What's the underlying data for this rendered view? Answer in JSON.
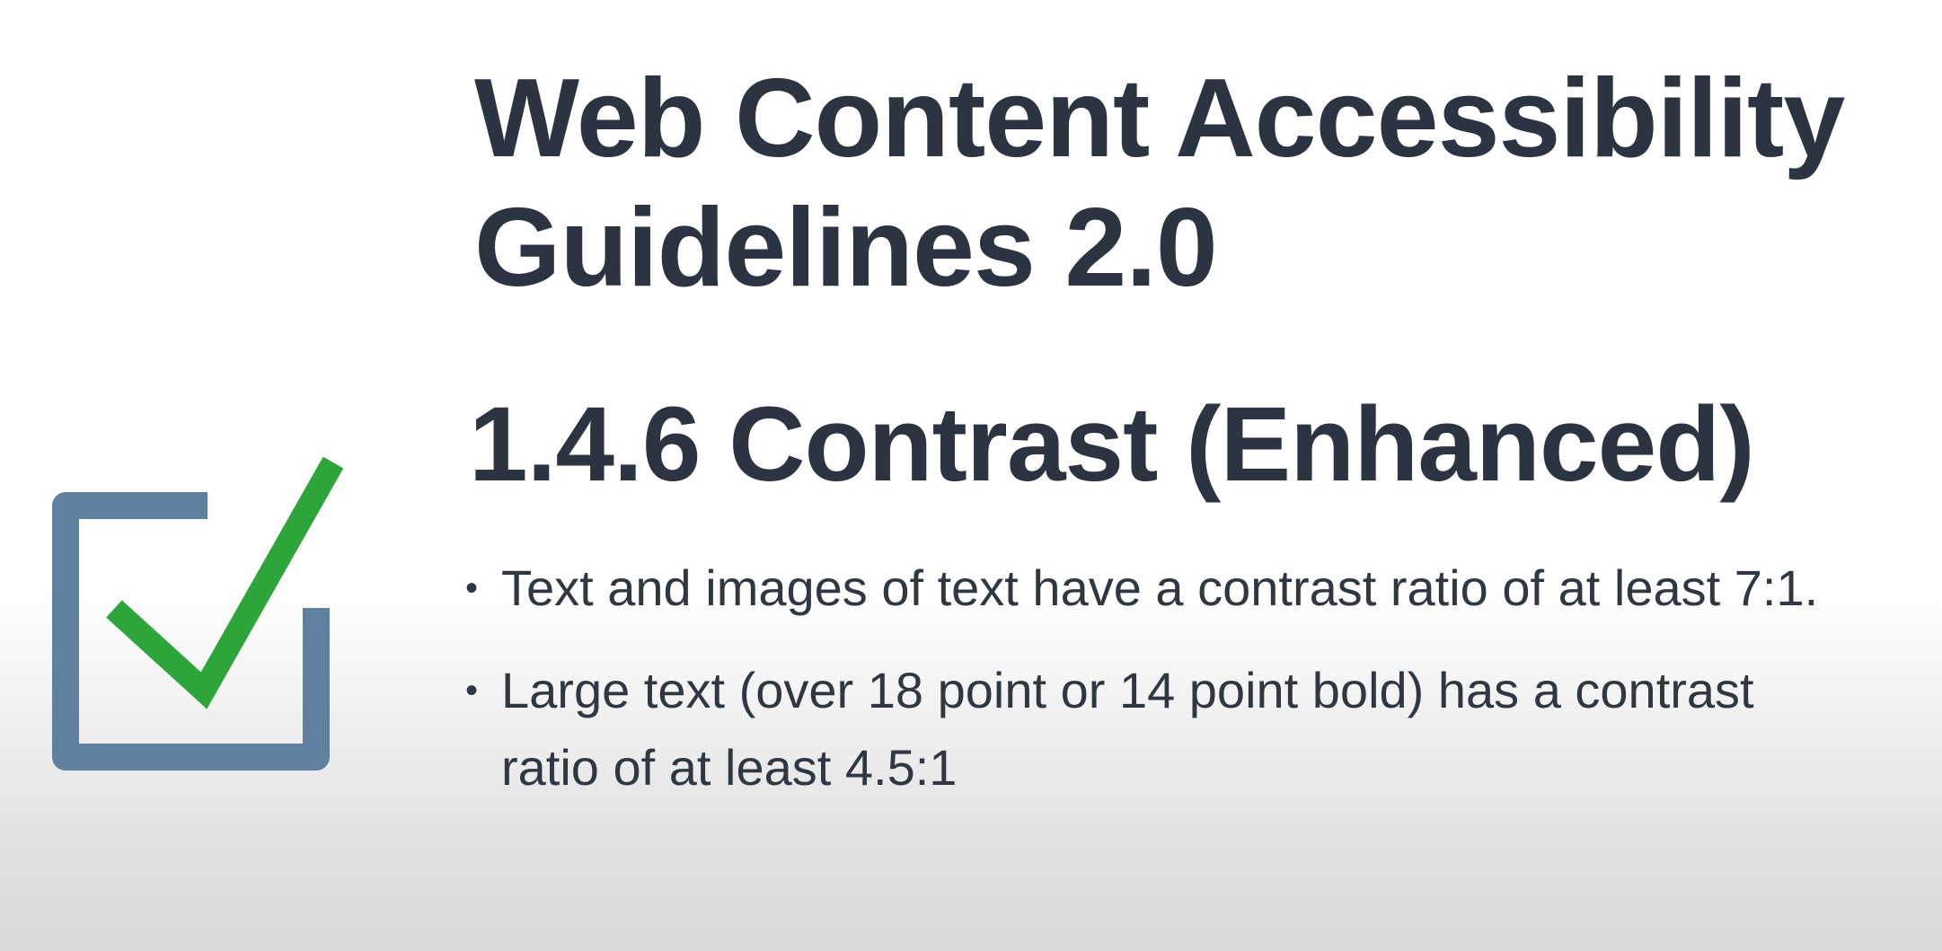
{
  "slide": {
    "title": "Web Content Accessibility Guidelines 2.0",
    "subtitle": "1.4.6 Contrast (Enhanced)",
    "bullets": [
      {
        "text": "Text and images of text have a contrast ratio of at least 7:1."
      },
      {
        "text": "Large text (over 18 point or 14 point bold) has a contrast ratio of at least 4.5:1"
      }
    ],
    "bullet_glyph": "•"
  },
  "icons": {
    "checkbox": "checked-checkbox-icon"
  },
  "colors": {
    "text": "#2b3440",
    "checkbox_frame": "#5f80a0",
    "checkmark": "#2ea53a"
  }
}
